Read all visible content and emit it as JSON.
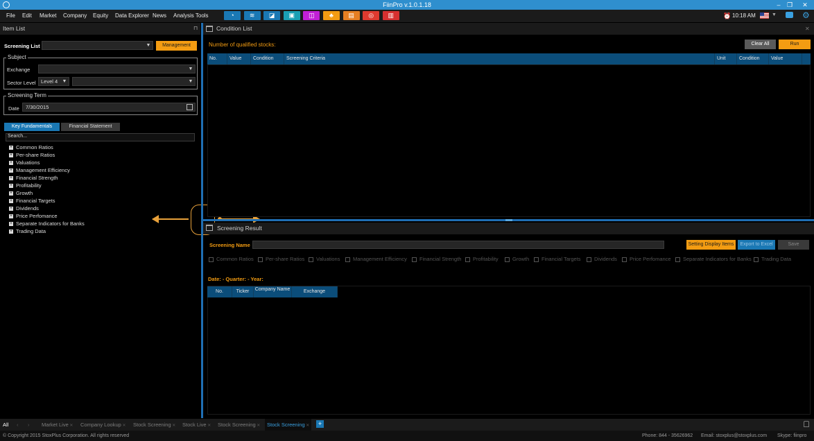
{
  "title": "FiinPro v.1.0.1.18",
  "menu": [
    "File",
    "Edit",
    "Market",
    "Company",
    "Equity",
    "Data Explorer",
    "News",
    "Analysis Tools"
  ],
  "toolbar_icons": [
    {
      "name": "dashboard-icon",
      "color": "#1a78b4",
      "glyph": "◔"
    },
    {
      "name": "market-icon",
      "color": "#1a78b4",
      "glyph": "≋"
    },
    {
      "name": "chart-icon",
      "color": "#1a78b4",
      "glyph": "◪"
    },
    {
      "name": "screen-icon",
      "color": "#1a9fb4",
      "glyph": "▣"
    },
    {
      "name": "analysis-icon",
      "color": "#c21fd6",
      "glyph": "◫"
    },
    {
      "name": "people-icon",
      "color": "#f39c12",
      "glyph": "♣"
    },
    {
      "name": "presentation-icon",
      "color": "#e67e22",
      "glyph": "▤"
    },
    {
      "name": "target-icon",
      "color": "#e03a2f",
      "glyph": "◎"
    },
    {
      "name": "bar-chart-icon",
      "color": "#d63030",
      "glyph": "▥"
    }
  ],
  "header_right": {
    "time": "10:18 AM"
  },
  "item_list": {
    "title": "Item List",
    "screening_list_label": "Screening List",
    "management_label": "Management",
    "subject_legend": "Subject",
    "exchange_label": "Exchange",
    "sector_level_label": "Sector Level",
    "sector_level_value": "Level 4",
    "screening_term_legend": "Screening Term",
    "date_label": "Date",
    "date_value": "7/30/2015",
    "tabs": [
      "Key Fundamentals",
      "Financial Statement"
    ],
    "search_placeholder": "Search...",
    "tree": [
      "Common Ratios",
      "Per-share Ratios",
      "Valuations",
      "Management Efficiency",
      "Financial Strength",
      "Profitability",
      "Growth",
      "Financial Targets",
      "Dividends",
      "Price Perfomance",
      "Separate Indicators for Banks",
      "Trading Data"
    ]
  },
  "condition_list": {
    "title": "Condition List",
    "qualified_label": "Number of qualified stocks:",
    "clear_all": "Clear All",
    "run": "Run",
    "columns": [
      "No.",
      "Value",
      "Condition",
      "Screening Criteria",
      "Unit",
      "Condition",
      "Value"
    ]
  },
  "screening_result": {
    "title": "Screening Result",
    "name_label": "Screening Name",
    "setting_btn": "Setting Display Items",
    "export_btn": "Export to Excel",
    "save_btn": "Save",
    "checkboxes": [
      "Common Ratios",
      "Per-share Ratios",
      "Valuations",
      "Management Efficiency",
      "Financial Strength",
      "Profitability",
      "Growth",
      "Financial Targets",
      "Dividends",
      "Price Perfomance",
      "Separate Indicators for Banks",
      "Trading Data"
    ],
    "date_line": "Date:  - Quarter: - Year:",
    "columns": [
      "No.",
      "Ticker",
      "Company Name",
      "Exchange"
    ]
  },
  "bottom_tabs": {
    "all": "All",
    "tabs": [
      "Market Live",
      "Company Lookup",
      "Stock Screening",
      "Stock Live",
      "Stock Screening",
      "Stock Screening"
    ],
    "active_index": 5
  },
  "status": {
    "copyright": "© Copyright 2015 StoxPlus Corporation. All rights reserved",
    "phone": "Phone: 844 - 35626962",
    "email": "Email: stoxplus@stoxplus.com",
    "skype": "Skype: fiinpro"
  },
  "colors": {
    "accent_orange": "#f39c12",
    "accent_blue": "#1a78b4",
    "title_bar": "#2f8fce"
  }
}
